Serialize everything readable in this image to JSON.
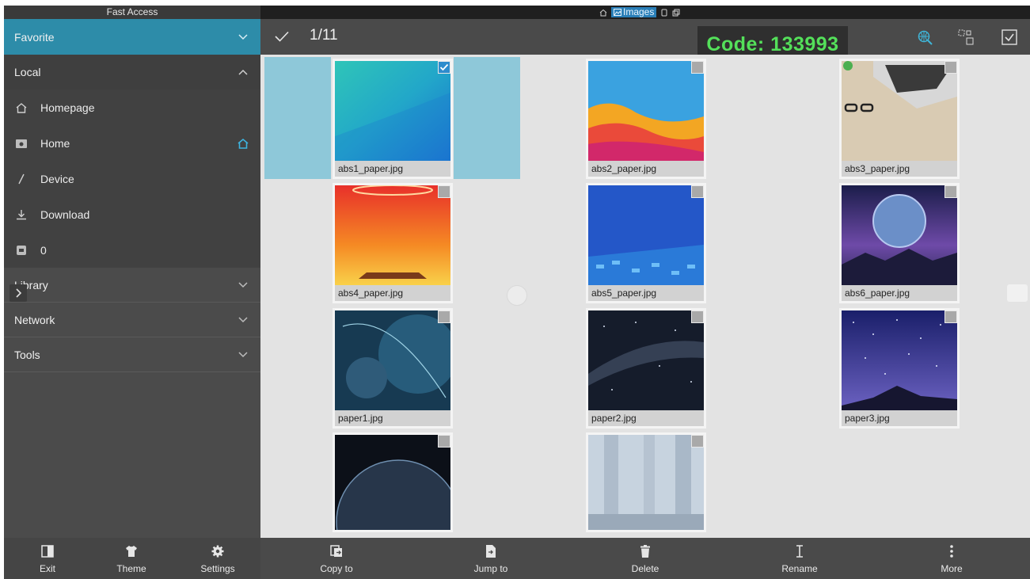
{
  "sidebar": {
    "header": "Fast Access",
    "favorite": "Favorite",
    "local": "Local",
    "local_items": [
      {
        "label": "Homepage",
        "icon": "homepage-icon"
      },
      {
        "label": "Home",
        "icon": "folder-camera-icon"
      },
      {
        "label": "Device",
        "icon": "slash-icon"
      },
      {
        "label": "Download",
        "icon": "download-icon"
      },
      {
        "label": "0",
        "icon": "sd-card-icon"
      }
    ],
    "library": "Library",
    "network": "Network",
    "tools": "Tools"
  },
  "breadcrumb": {
    "current": "Images"
  },
  "toolbar": {
    "selection_count": "1/11",
    "code": "Code: 133993"
  },
  "files": [
    {
      "name": "abs1_paper.jpg",
      "checked": true
    },
    {
      "name": "abs2_paper.jpg",
      "checked": false
    },
    {
      "name": "abs3_paper.jpg",
      "checked": false
    },
    {
      "name": "abs4_paper.jpg",
      "checked": false
    },
    {
      "name": "abs5_paper.jpg",
      "checked": false
    },
    {
      "name": "abs6_paper.jpg",
      "checked": false
    },
    {
      "name": "paper1.jpg",
      "checked": false
    },
    {
      "name": "paper2.jpg",
      "checked": false
    },
    {
      "name": "paper3.jpg",
      "checked": false
    },
    {
      "name": "",
      "checked": false
    },
    {
      "name": "",
      "checked": false
    }
  ],
  "bottom": {
    "exit": "Exit",
    "theme": "Theme",
    "settings": "Settings",
    "copy_to": "Copy to",
    "jump_to": "Jump to",
    "delete": "Delete",
    "rename": "Rename",
    "more": "More"
  },
  "colors": {
    "accent": "#2d8ca9",
    "code_text": "#54e05a",
    "selection_bg": "#8ec8d9"
  }
}
